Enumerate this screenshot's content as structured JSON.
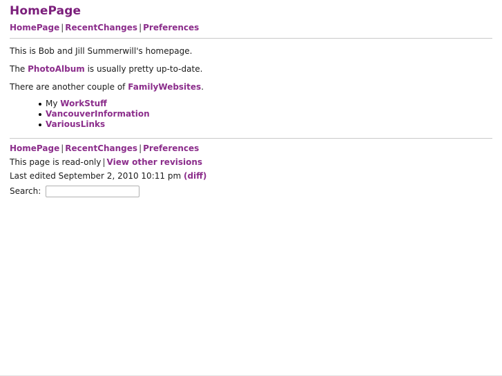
{
  "page": {
    "title": "HomePage"
  },
  "topnav": {
    "separator": "|",
    "items": [
      {
        "label": "HomePage"
      },
      {
        "label": "RecentChanges"
      },
      {
        "label": "Preferences"
      }
    ]
  },
  "main": {
    "paragraphs": [
      {
        "segments": [
          {
            "text": "This is Bob and Jill Summerwill's homepage.",
            "link": false
          }
        ]
      },
      {
        "segments": [
          {
            "text": "The ",
            "link": false
          },
          {
            "text": "PhotoAlbum",
            "link": true
          },
          {
            "text": " is usually pretty up-to-date.",
            "link": false
          }
        ]
      },
      {
        "segments": [
          {
            "text": "There are another couple of ",
            "link": false
          },
          {
            "text": "FamilyWebsites",
            "link": true
          },
          {
            "text": ".",
            "link": false
          }
        ]
      }
    ],
    "list": [
      {
        "segments": [
          {
            "text": "My ",
            "link": false
          },
          {
            "text": "WorkStuff",
            "link": true
          }
        ]
      },
      {
        "segments": [
          {
            "text": "VancouverInformation",
            "link": true
          }
        ]
      },
      {
        "segments": [
          {
            "text": "VariousLinks",
            "link": true
          }
        ]
      }
    ]
  },
  "footer": {
    "separator": "|",
    "nav": [
      {
        "label": "HomePage"
      },
      {
        "label": "RecentChanges"
      },
      {
        "label": "Preferences"
      }
    ],
    "readonly_text": "This page is read-only",
    "readonly_separator": "|",
    "revisions_link": "View other revisions",
    "last_edited_text": "Last edited September 2, 2010 10:11 pm",
    "diff_link": "(diff)"
  },
  "search": {
    "label": "Search:",
    "value": "",
    "placeholder": ""
  },
  "colors": {
    "link": "#8b2d8b",
    "title": "#7b1e7b",
    "text": "#1a1a1a",
    "rule": "#c8c8c8",
    "background": "#ffffff"
  }
}
